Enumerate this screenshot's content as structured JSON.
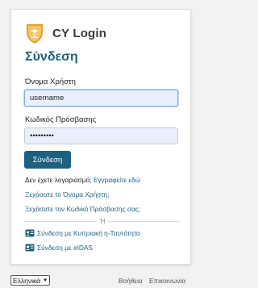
{
  "brand": {
    "title": "CY Login",
    "emblem_icon": "cyprus-coat-of-arms-icon"
  },
  "page_title": "Σύνδεση",
  "form": {
    "username_label": "Όνομα Χρήστη",
    "username_value": "username",
    "password_label": "Κωδικός Πρόσβασης",
    "password_value": "•••••••••",
    "submit_label": "Σύνδεση"
  },
  "links": {
    "no_account_text": "Δεν έχετε λογαριασμό;",
    "register_label": "Εγγραφείτε εδώ",
    "forgot_username_label": "Ξεχάσατε το Όνομα Χρήστη;",
    "forgot_password_label": "Ξεχάσατε τον Κωδικό Πρόσβασης σας;"
  },
  "divider_text": "Ή",
  "alt_logins": {
    "id_card_label": "Σύνδεση με Κυπριακή η-Ταυτότητα",
    "eidas_label": "Σύνδεση με eIDAS",
    "icon": "id-card-icon"
  },
  "footer": {
    "language_selected": "Ελληνικά",
    "help_label": "Βοήθεια",
    "contact_label": "Επικοινωνία"
  },
  "colors": {
    "accent": "#1e6082",
    "input_fill": "#e8f0fe",
    "emblem_gold": "#e2a12a",
    "page_background": "#f2f2f2"
  }
}
